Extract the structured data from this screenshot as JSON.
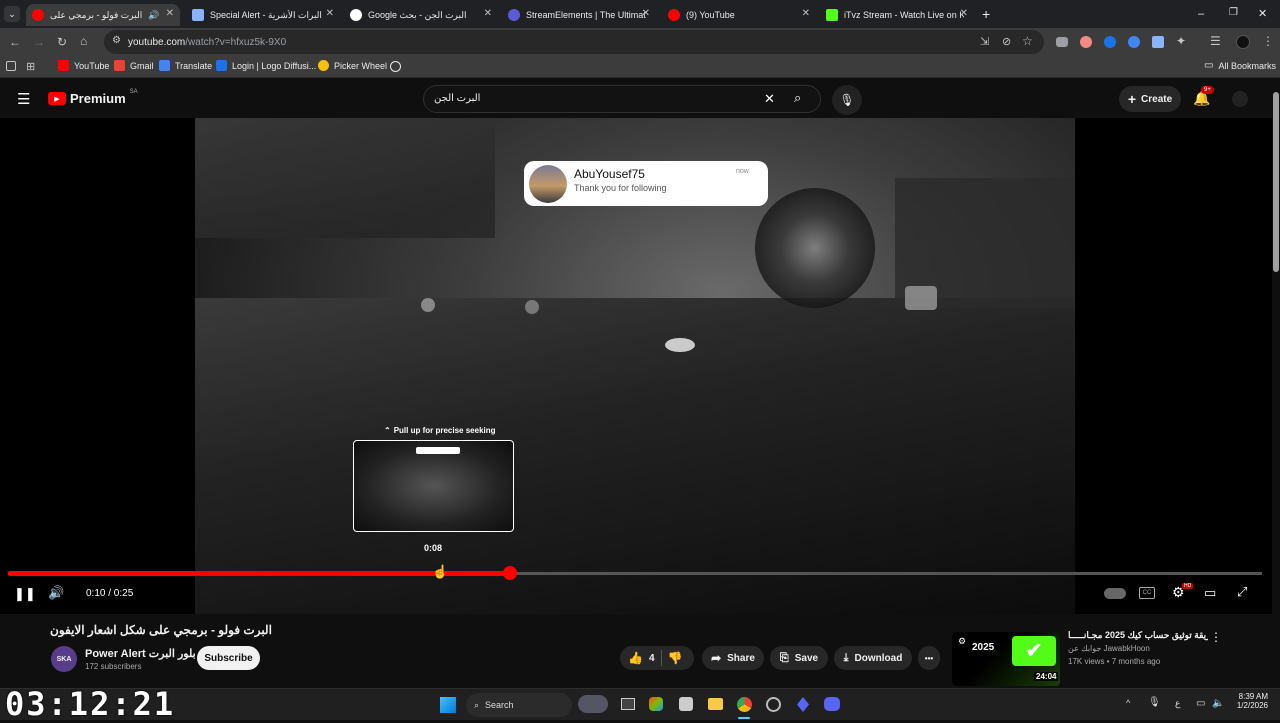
{
  "browser": {
    "tabs": [
      {
        "label": "البرت فولو - برمجي على",
        "active": true,
        "favicon_color": "#ff0000"
      },
      {
        "label": "Special Alert - البرات الأشرية",
        "active": false,
        "favicon_color": "#8ab4f8"
      },
      {
        "label": "Google البرت الجن - بحث",
        "active": false,
        "favicon_color": "#ffffff"
      },
      {
        "label": "StreamElements | The Ultimate",
        "active": false,
        "favicon_color": "#5b5bd6"
      },
      {
        "label": "(9) YouTube",
        "active": false,
        "favicon_color": "#ff0000"
      },
      {
        "label": "iTvz Stream - Watch Live on Ki",
        "active": false,
        "favicon_color": "#53fc18"
      }
    ],
    "new_tab_label": "+",
    "url_host": "youtube.com",
    "url_path": "/watch?v=hfxuz5k-9X0",
    "bookmarks": [
      {
        "label": "YouTube",
        "color": "#ff0000"
      },
      {
        "label": "Gmail",
        "color": "#ea4335"
      },
      {
        "label": "Translate",
        "color": "#4285f4"
      },
      {
        "label": "Login | Logo Diffusi...",
        "color": "#1a73e8"
      },
      {
        "label": "Picker Wheel",
        "color": "#f4c20d"
      }
    ],
    "all_bookmarks": "All Bookmarks"
  },
  "masthead": {
    "logo_text": "Premium",
    "region": "SA",
    "search_value": "البرت الجن",
    "create_label": "Create",
    "notif_badge": "9+"
  },
  "player": {
    "toast": {
      "user": "AbuYousef75",
      "message": "Thank you for following",
      "time": "now"
    },
    "seek_hint": "Pull up for precise seeking",
    "preview_time": "0:08",
    "time_display": "0:10 / 0:25",
    "progress_fraction": 0.4,
    "settings_badge": "HD"
  },
  "video": {
    "title": "البرت فولو - برمجي على شكل اشعار الايفون",
    "channel_avatar": "SKA",
    "channel_name": "Power Alert بلور البرت",
    "subscribers": "172 subscribers",
    "subscribe_label": "Subscribe",
    "likes": "4",
    "share_label": "Share",
    "save_label": "Save",
    "download_label": "Download",
    "more_label": "•••"
  },
  "recommendation": {
    "title": "طريقة توثيق حساب كيك 2025 مجـانـــــا",
    "channel": "جوابك عن JawabkHoon",
    "meta": "17K views • 7 months ago",
    "duration": "24:04",
    "thumb_text": "2025"
  },
  "overlay_clock": "03:12:21",
  "taskbar": {
    "search_label": "Search",
    "time": "8:39 AM",
    "date": "1/2/2026",
    "lang": "ع"
  }
}
